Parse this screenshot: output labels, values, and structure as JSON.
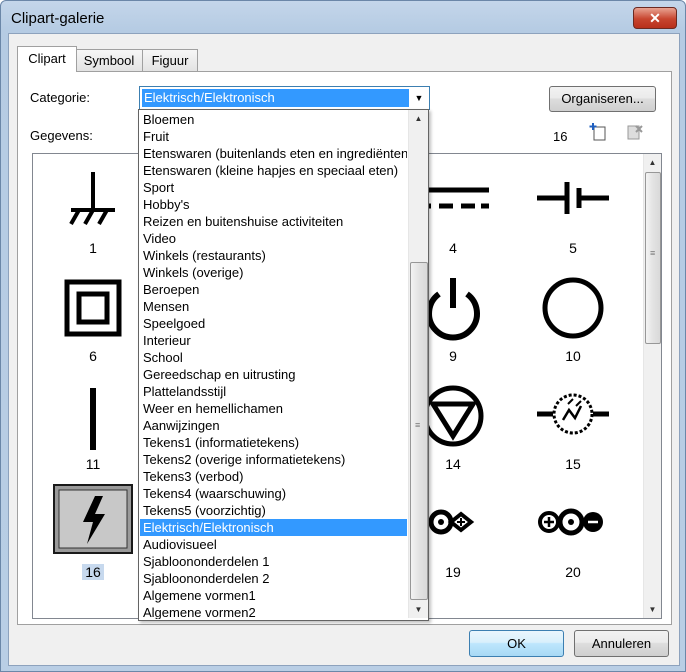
{
  "window": {
    "title": "Clipart-galerie",
    "close": "✕"
  },
  "tabs": [
    "Clipart",
    "Symbool",
    "Figuur"
  ],
  "category_label": "Categorie:",
  "category_value": "Elektrisch/Elektronisch",
  "organize_button": "Organiseren...",
  "data_label": "Gegevens:",
  "count": "16",
  "toolbar_icons": [
    "new-clip-icon",
    "delete-clip-icon"
  ],
  "gallery": {
    "items": [
      "1",
      "4",
      "5",
      "6",
      "9",
      "10",
      "11",
      "14",
      "15",
      "16",
      "19",
      "20"
    ],
    "selected": "16"
  },
  "dropdown": {
    "items": [
      "Bloemen",
      "Fruit",
      "Etenswaren (buitenlands eten en ingrediënten)",
      "Etenswaren (kleine hapjes en speciaal eten)",
      "Sport",
      "Hobby's",
      "Reizen en buitenshuise activiteiten",
      "Video",
      "Winkels (restaurants)",
      "Winkels (overige)",
      "Beroepen",
      "Mensen",
      "Speelgoed",
      "Interieur",
      "School",
      "Gereedschap en uitrusting",
      "Plattelandsstijl",
      "Weer en hemellichamen",
      "Aanwijzingen",
      "Tekens1 (informatietekens)",
      "Tekens2 (overige informatietekens)",
      "Tekens3 (verbod)",
      "Tekens4 (waarschuwing)",
      "Tekens5 (voorzichtig)",
      "Elektrisch/Elektronisch",
      "Audiovisueel",
      "Sjabloononderdelen 1",
      "Sjabloononderdelen 2",
      "Algemene vormen1",
      "Algemene vormen2"
    ],
    "selected_index": 24
  },
  "ok_button": "OK",
  "cancel_button": "Annuleren"
}
